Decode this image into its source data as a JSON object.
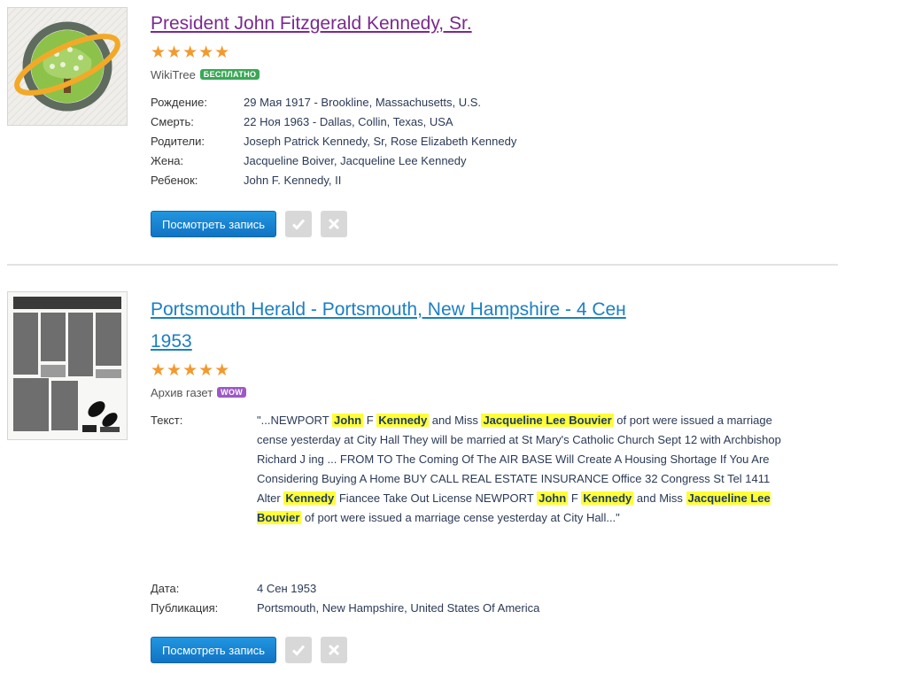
{
  "records": [
    {
      "title": "President John Fitzgerald Kennedy, Sr.",
      "title_color": "#7a2a8f",
      "stars": "★★★★★",
      "source": "WikiTree",
      "badge": "БЕСПЛАТНО",
      "badge_color": "#3aa757",
      "fields": [
        {
          "label": "Рождение:",
          "value": "29 Мая 1917 - Brookline, Massachusetts, U.S."
        },
        {
          "label": "Смерть:",
          "value": "22 Ноя 1963 - Dallas, Collin, Texas, USA"
        },
        {
          "label": "Родители:",
          "value": "Joseph Patrick Kennedy, Sr, Rose Elizabeth Kennedy"
        },
        {
          "label": "Жена:",
          "value": "Jacqueline Boiver, Jacqueline Lee Kennedy"
        },
        {
          "label": "Ребенок:",
          "value": "John F. Kennedy, II"
        }
      ],
      "view_button": "Посмотреть запись",
      "thumbnail_icon": "wikitree-tree-logo-icon"
    },
    {
      "title_line1": "Portsmouth Herald - Portsmouth, New Hampshire - 4 Сен",
      "title_line2": "1953",
      "title_color": "#1b7fc4",
      "stars": "★★★★★",
      "source": "Архив газет",
      "badge": "WOW",
      "badge_color": "#9b59c6",
      "text_label": "Текст:",
      "text_segments": [
        {
          "t": "\"...NEWPORT "
        },
        {
          "t": "John",
          "hl": true
        },
        {
          "t": " F "
        },
        {
          "t": "Kennedy",
          "hl": true
        },
        {
          "t": " and Miss "
        },
        {
          "t": "Jacqueline Lee Bouvier",
          "hl": true
        },
        {
          "t": " of port were issued a marriage cense yesterday at City Hall They will be married at St Mary's Catholic Church Sept 12 with Archbishop Richard J ing ... FROM TO The Coming Of The AIR BASE Will Create A Housing Shortage If You Are Considering Buying A Home BUY CALL REAL ESTATE INSURANCE Office 32 Congress St Tel 1411 Alter "
        },
        {
          "t": "Kennedy",
          "hl": true
        },
        {
          "t": " Fiancee Take Out License NEWPORT "
        },
        {
          "t": "John",
          "hl": true
        },
        {
          "t": " F "
        },
        {
          "t": "Kennedy",
          "hl": true
        },
        {
          "t": " and Miss "
        },
        {
          "t": "Jacqueline Lee Bouvier",
          "hl": true
        },
        {
          "t": " of port were issued a marriage cense yesterday at City Hall...\""
        }
      ],
      "fields": [
        {
          "label": "Дата:",
          "value": "4 Сен 1953"
        },
        {
          "label": "Публикация:",
          "value": "Portsmouth, New Hampshire, United States Of America"
        }
      ],
      "view_button": "Посмотреть запись",
      "thumbnail_icon": "newspaper-page-icon"
    }
  ]
}
